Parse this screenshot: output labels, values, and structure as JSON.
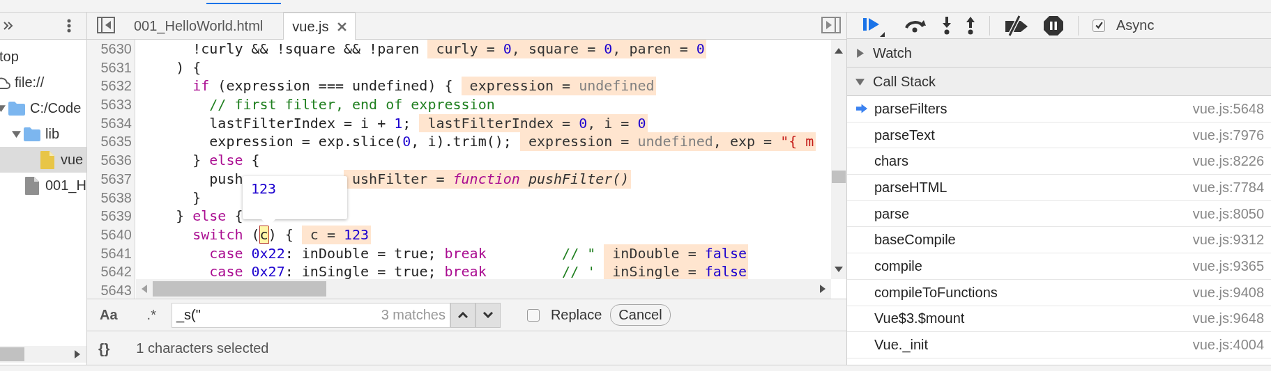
{
  "navigator": {
    "tree": [
      {
        "label": "top",
        "selected": false,
        "children": [
          {
            "label": "file://",
            "kind": "origin",
            "selected": false,
            "children": [
              {
                "label": "C:/Code",
                "kind": "folder",
                "expanded": true,
                "selected": false,
                "children": [
                  {
                    "label": "lib",
                    "kind": "folder",
                    "expanded": true,
                    "selected": false,
                    "children": [
                      {
                        "label": "vue",
                        "kind": "script",
                        "selected": true
                      }
                    ]
                  },
                  {
                    "label": "001_H",
                    "kind": "document",
                    "selected": false
                  }
                ]
              }
            ]
          }
        ]
      }
    ]
  },
  "editor": {
    "tabs": [
      {
        "label": "001_HelloWorld.html",
        "selected": false,
        "closable": false
      },
      {
        "label": "vue.js",
        "selected": true,
        "closable": true
      }
    ],
    "lines": [
      {
        "number": "5630",
        "code": [
          {
            "kind": "plain",
            "text": "      !curly && !square && !paren"
          }
        ],
        "value": [
          {
            "kind": "plain",
            "text": "curly = "
          },
          {
            "kind": "number",
            "text": "0"
          },
          {
            "kind": "plain",
            "text": ", square = "
          },
          {
            "kind": "number",
            "text": "0"
          },
          {
            "kind": "plain",
            "text": ", paren = "
          },
          {
            "kind": "number",
            "text": "0"
          }
        ]
      },
      {
        "number": "5631",
        "code": [
          {
            "kind": "plain",
            "text": "    ) {"
          }
        ]
      },
      {
        "number": "5632",
        "code": [
          {
            "kind": "keyword",
            "text": "      if"
          },
          {
            "kind": "plain",
            "text": " (expression === undefined) {"
          }
        ],
        "value": [
          {
            "kind": "plain",
            "text": "expression = "
          },
          {
            "kind": "undefined",
            "text": "undefined"
          }
        ]
      },
      {
        "number": "5633",
        "code": [
          {
            "kind": "comment",
            "text": "        // first filter, end of expression"
          }
        ]
      },
      {
        "number": "5634",
        "code": [
          {
            "kind": "plain",
            "text": "        lastFilterIndex = i + "
          },
          {
            "kind": "number",
            "text": "1"
          },
          {
            "kind": "plain",
            "text": ";"
          }
        ],
        "value": [
          {
            "kind": "plain",
            "text": "lastFilterIndex = "
          },
          {
            "kind": "number",
            "text": "0"
          },
          {
            "kind": "plain",
            "text": ", i = "
          },
          {
            "kind": "number",
            "text": "0"
          }
        ]
      },
      {
        "number": "5635",
        "code": [
          {
            "kind": "plain",
            "text": "        expression = exp.slice("
          },
          {
            "kind": "number",
            "text": "0"
          },
          {
            "kind": "plain",
            "text": ", i).trim();"
          }
        ],
        "value": [
          {
            "kind": "plain",
            "text": "expression = "
          },
          {
            "kind": "undefined",
            "text": "undefined"
          },
          {
            "kind": "plain",
            "text": ", exp = "
          },
          {
            "kind": "string",
            "text": "\"{ m"
          }
        ]
      },
      {
        "number": "5636",
        "code": [
          {
            "kind": "plain",
            "text": "      } "
          },
          {
            "kind": "keyword",
            "text": "else"
          },
          {
            "kind": "plain",
            "text": " {"
          }
        ]
      },
      {
        "number": "5637",
        "covered": true,
        "code": [
          {
            "kind": "plain",
            "text": "        push"
          }
        ],
        "value": [
          {
            "kind": "plain",
            "text": "ushFilter = "
          },
          {
            "kind": "fn-keyword",
            "text": "function"
          },
          {
            "kind": "fn-name",
            "text": " pushFilter()"
          }
        ]
      },
      {
        "number": "5638",
        "code": [
          {
            "kind": "plain",
            "text": "      }"
          }
        ]
      },
      {
        "number": "5639",
        "code": [
          {
            "kind": "plain",
            "text": "    } "
          },
          {
            "kind": "keyword",
            "text": "else"
          },
          {
            "kind": "plain",
            "text": " {"
          }
        ]
      },
      {
        "number": "5640",
        "code": [
          {
            "kind": "keyword",
            "text": "      switch"
          },
          {
            "kind": "plain",
            "text": " ("
          },
          {
            "kind": "match",
            "text": "c"
          },
          {
            "kind": "plain",
            "text": ") {"
          }
        ],
        "value": [
          {
            "kind": "plain",
            "text": "c = "
          },
          {
            "kind": "number",
            "text": "123"
          }
        ]
      },
      {
        "number": "5641",
        "code": [
          {
            "kind": "keyword",
            "text": "        case"
          },
          {
            "kind": "number",
            "text": " 0x22"
          },
          {
            "kind": "plain",
            "text": ": inDouble = true; "
          },
          {
            "kind": "keyword",
            "text": "break"
          },
          {
            "kind": "comment",
            "text": "         // \""
          }
        ],
        "value": [
          {
            "kind": "plain",
            "text": "inDouble = "
          },
          {
            "kind": "number",
            "text": "false"
          }
        ]
      },
      {
        "number": "5642",
        "code": [
          {
            "kind": "keyword",
            "text": "        case"
          },
          {
            "kind": "number",
            "text": " 0x27"
          },
          {
            "kind": "plain",
            "text": ": inSingle = true; "
          },
          {
            "kind": "keyword",
            "text": "break"
          },
          {
            "kind": "comment",
            "text": "         // '"
          }
        ],
        "value": [
          {
            "kind": "plain",
            "text": "inSingle = "
          },
          {
            "kind": "number",
            "text": "false"
          }
        ]
      },
      {
        "number": "5643"
      }
    ],
    "tooltip": {
      "value": "123"
    },
    "search": {
      "case_label": "Aa",
      "regex_label": ".*",
      "value": "_s(\"",
      "matches": "3 matches",
      "replace_checked": false,
      "replace_label": "Replace",
      "cancel": "Cancel"
    },
    "status_bar": {
      "format_label": "{}",
      "text": "1 characters selected"
    }
  },
  "debugger": {
    "async_checked": true,
    "async_label": "Async",
    "sections": [
      {
        "title": "Watch",
        "expanded": false
      },
      {
        "title": "Call Stack",
        "expanded": true
      }
    ],
    "call_stack": [
      {
        "name": "parseFilters",
        "location": "vue.js:5648",
        "current": true
      },
      {
        "name": "parseText",
        "location": "vue.js:7976",
        "current": false
      },
      {
        "name": "chars",
        "location": "vue.js:8226",
        "current": false
      },
      {
        "name": "parseHTML",
        "location": "vue.js:7784",
        "current": false
      },
      {
        "name": "parse",
        "location": "vue.js:8050",
        "current": false
      },
      {
        "name": "baseCompile",
        "location": "vue.js:9312",
        "current": false
      },
      {
        "name": "compile",
        "location": "vue.js:9365",
        "current": false
      },
      {
        "name": "compileToFunctions",
        "location": "vue.js:9408",
        "current": false
      },
      {
        "name": "Vue$3.$mount",
        "location": "vue.js:9648",
        "current": false
      },
      {
        "name": "Vue._init",
        "location": "vue.js:4004",
        "current": false
      }
    ]
  }
}
